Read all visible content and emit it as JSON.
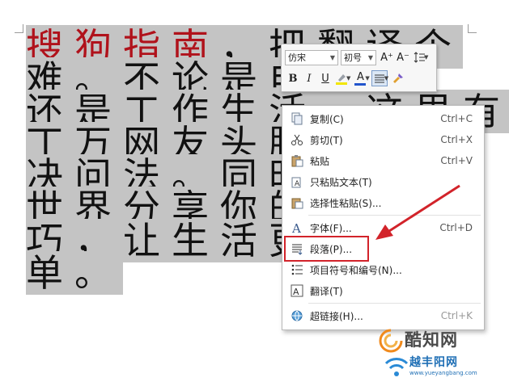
{
  "document": {
    "lines": [
      {
        "red": "搜狗指南",
        "rest": "，把翻译个"
      },
      {
        "red": "",
        "rest": "难。不论是电脑上"
      },
      {
        "red": "",
        "rest": "还是工作生活，这里有"
      },
      {
        "red": "",
        "rest": "丁万网友头脑"
      },
      {
        "red": "",
        "rest": "决问法。同时"
      },
      {
        "red": "",
        "rest": "世界分享你的"
      },
      {
        "red": "",
        "rest": "巧，让生活更"
      },
      {
        "red": "",
        "rest": "单。"
      }
    ]
  },
  "mini_toolbar": {
    "font_name": "仿宋",
    "font_size": "初号",
    "grow_font": "A⁺",
    "shrink_font": "A⁻",
    "bold": "B",
    "italic": "I",
    "underline": "U",
    "font_color_letter": "A"
  },
  "context_menu": {
    "items": [
      {
        "label": "复制(C)",
        "shortcut": "Ctrl+C",
        "icon": "copy-icon"
      },
      {
        "label": "剪切(T)",
        "shortcut": "Ctrl+X",
        "icon": "scissors-icon"
      },
      {
        "label": "粘贴",
        "shortcut": "Ctrl+V",
        "icon": "paste-icon"
      },
      {
        "label": "只粘贴文本(T)",
        "shortcut": "",
        "icon": "paste-text-icon"
      },
      {
        "label": "选择性粘贴(S)...",
        "shortcut": "",
        "icon": "paste-special-icon"
      },
      {
        "label": "字体(F)...",
        "shortcut": "Ctrl+D",
        "icon": "font-icon"
      },
      {
        "label": "段落(P)...",
        "shortcut": "",
        "icon": "paragraph-icon"
      },
      {
        "label": "项目符号和编号(N)...",
        "shortcut": "",
        "icon": "bullets-icon"
      },
      {
        "label": "翻译(T)",
        "shortcut": "",
        "icon": "translate-icon"
      },
      {
        "label": "超链接(H)...",
        "shortcut": "Ctrl+K",
        "icon": "hyperlink-icon"
      }
    ]
  },
  "colors": {
    "highlight_box": "#d2232a",
    "arrow": "#d2232a",
    "selection": "#c4c4c4",
    "red_text": "#b0121b"
  },
  "watermark": {
    "big": "酷知网",
    "small": "越丰阳网",
    "url": "www.yueyangbang.com"
  }
}
